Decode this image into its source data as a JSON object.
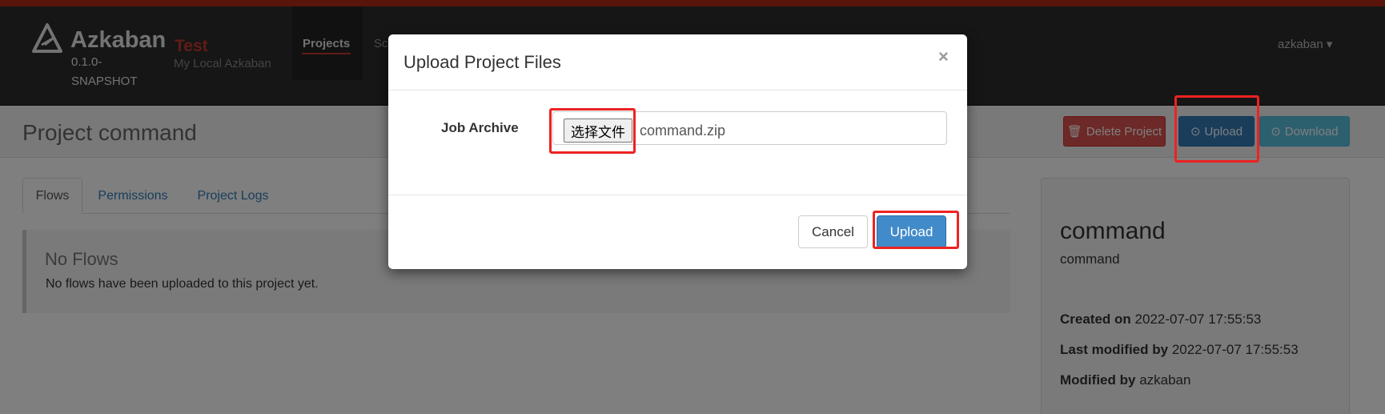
{
  "navbar": {
    "brand": "Azkaban",
    "version": "0.1.0-SNAPSHOT",
    "env_name": "Test",
    "env_desc": "My Local Azkaban",
    "nav_items": [
      "Projects",
      "Sc"
    ],
    "user": "azkaban ▾"
  },
  "page": {
    "title": "Project command",
    "buttons": {
      "delete": "Delete Project",
      "upload": "Upload",
      "download": "Download"
    },
    "tabs": [
      "Flows",
      "Permissions",
      "Project Logs"
    ],
    "no_flows_title": "No Flows",
    "no_flows_text": "No flows have been uploaded to this project yet."
  },
  "side": {
    "name": "command",
    "description": "command",
    "created_label": "Created on",
    "created_value": "2022-07-07 17:55:53",
    "modified_label": "Last modified by",
    "modified_value": "2022-07-07 17:55:53",
    "modified_by_label": "Modified by",
    "modified_by_value": "azkaban"
  },
  "modal": {
    "title": "Upload Project Files",
    "close": "×",
    "job_label": "Job Archive",
    "choose_file": "选择文件",
    "file_name": "command.zip",
    "cancel": "Cancel",
    "upload": "Upload"
  },
  "colors": {
    "accent_red": "#c0392b",
    "primary_blue": "#337ab7",
    "highlight": "#ee2222"
  }
}
